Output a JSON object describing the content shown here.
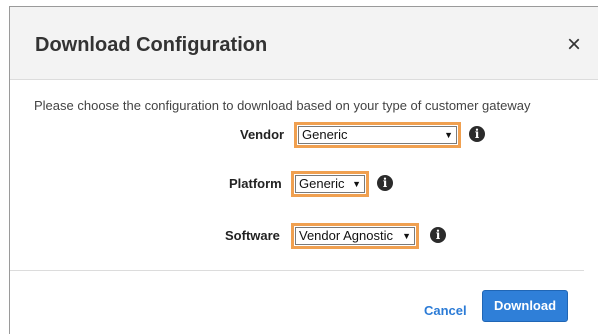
{
  "dialog": {
    "title": "Download Configuration",
    "close_symbol": "×",
    "instructions": "Please choose the configuration to download based on your type of customer gateway"
  },
  "fields": {
    "vendor": {
      "label": "Vendor",
      "value": "Generic"
    },
    "platform": {
      "label": "Platform",
      "value": "Generic"
    },
    "software": {
      "label": "Software",
      "value": "Vendor Agnostic"
    }
  },
  "icons": {
    "info": "info-icon",
    "close": "close-icon",
    "dropdown": "dropdown-arrow-icon"
  },
  "footer": {
    "cancel_label": "Cancel",
    "download_label": "Download"
  },
  "colors": {
    "highlight": "#f0a050",
    "primary": "#2f7fd8",
    "link": "#2b7bd6"
  }
}
